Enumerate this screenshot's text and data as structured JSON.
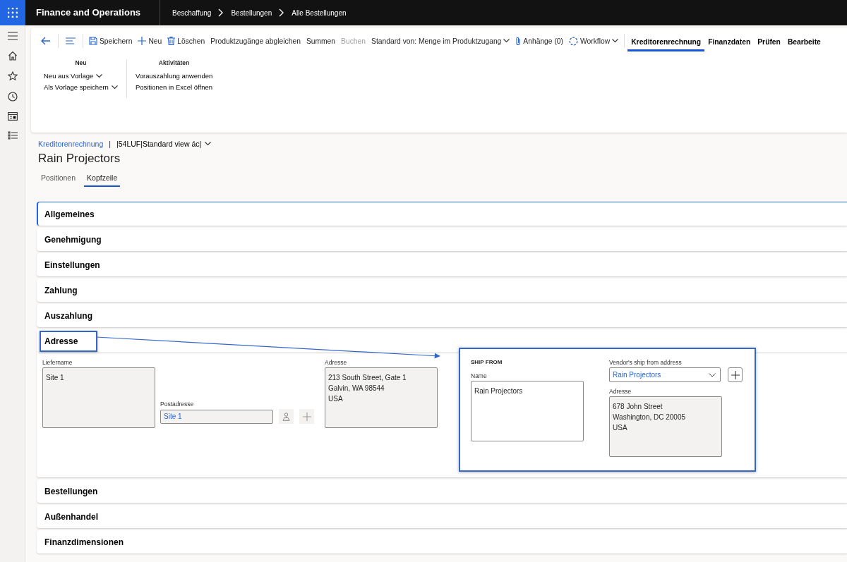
{
  "app_title": "Finance and Operations",
  "breadcrumb": [
    "Beschaffung",
    "Bestellungen",
    "Alle Bestellungen"
  ],
  "toolbar": [
    {
      "label": "Speichern",
      "kind": "save",
      "disabled": false
    },
    {
      "label": "Neu",
      "kind": "add",
      "disabled": false
    },
    {
      "label": "Löschen",
      "kind": "delete",
      "disabled": false
    },
    {
      "label": "Produktzugänge abgleichen",
      "kind": "text",
      "disabled": false
    },
    {
      "label": "Summen",
      "kind": "text",
      "disabled": false
    },
    {
      "label": "Buchen",
      "kind": "text",
      "disabled": true
    },
    {
      "label": "Standard von: Menge im Produktzugang",
      "kind": "dropdown",
      "disabled": false
    },
    {
      "label": "Anhänge (0)",
      "kind": "attach",
      "disabled": false
    },
    {
      "label": "Workflow",
      "kind": "workflow",
      "disabled": false
    }
  ],
  "action_tabs": [
    {
      "label": "Kreditorenrechnung",
      "selected": true
    },
    {
      "label": "Finanzdaten",
      "selected": false
    },
    {
      "label": "Prüfen",
      "selected": false
    },
    {
      "label": "Bearbeite",
      "selected": false
    }
  ],
  "ribbon_groups": [
    {
      "title": "Neu",
      "items": [
        {
          "label": "Neu aus Vorlage",
          "dropdown": true
        },
        {
          "label": "Als Vorlage speichern",
          "dropdown": true
        }
      ]
    },
    {
      "title": "Aktivitäten",
      "items": [
        {
          "label": "Vorauszahlung anwenden",
          "dropdown": false
        },
        {
          "label": "Positionen in Excel öffnen",
          "dropdown": false
        }
      ]
    }
  ],
  "form_link": "Kreditorenrechnung",
  "separator": "|",
  "view_name": "|54LUF|Standard view ác|",
  "title": "Rain Projectors",
  "tabs": [
    {
      "label": "Positionen",
      "selected": false
    },
    {
      "label": "Kopfzeile",
      "selected": true
    }
  ],
  "sections": [
    {
      "title": "Allgemeines",
      "expanded": false,
      "focused": true,
      "highlighted": false
    },
    {
      "title": "Genehmigung",
      "expanded": false,
      "focused": false,
      "highlighted": false
    },
    {
      "title": "Einstellungen",
      "expanded": false,
      "focused": false,
      "highlighted": false
    },
    {
      "title": "Zahlung",
      "expanded": false,
      "focused": false,
      "highlighted": false
    },
    {
      "title": "Auszahlung",
      "expanded": false,
      "focused": false,
      "highlighted": false
    },
    {
      "title": "Adresse",
      "expanded": true,
      "focused": false,
      "highlighted": true
    },
    {
      "title": "Bestellungen",
      "expanded": false,
      "focused": false,
      "highlighted": false
    },
    {
      "title": "Außenhandel",
      "expanded": false,
      "focused": false,
      "highlighted": false
    },
    {
      "title": "Finanzdimensionen",
      "expanded": false,
      "focused": false,
      "highlighted": false
    }
  ],
  "address": {
    "delivery_name": {
      "label": "Liefername",
      "value": "Site 1"
    },
    "postal_address": {
      "label": "Postadresse",
      "value": "Site 1"
    },
    "address": {
      "label": "Adresse",
      "lines": [
        "213 South Street, Gate 1",
        "Galvin, WA 98544",
        "USA"
      ]
    }
  },
  "ship_from": {
    "heading": "SHIP FROM",
    "highlighted": true,
    "name": {
      "label": "Name",
      "value": "Rain Projectors"
    },
    "vendor_address": {
      "label": "Vendor's ship from address",
      "value": "Rain Projectors"
    },
    "address": {
      "label": "Adresse",
      "lines": [
        "678 John Street",
        "Washington, DC 20005",
        "USA"
      ]
    }
  }
}
